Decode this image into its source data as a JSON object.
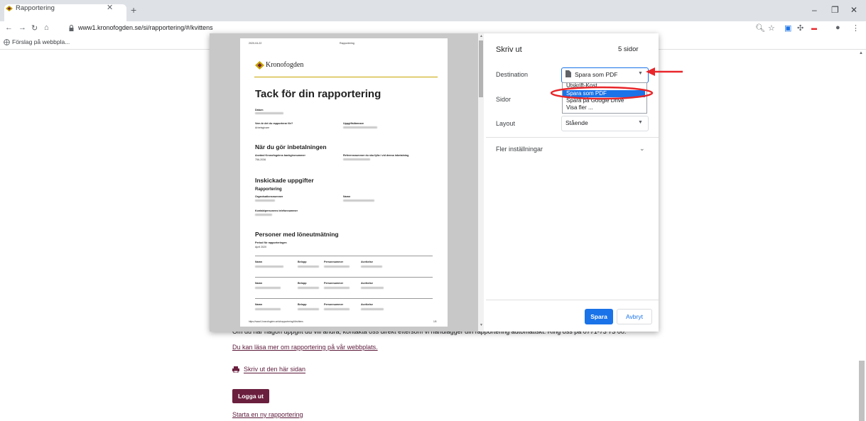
{
  "browser": {
    "tab_title": "Rapportering",
    "url": "www1.kronofogden.se/si/rapportering/#/kvittens",
    "bookmark": "Förslag på webbpla..."
  },
  "page": {
    "info_text": "Om du har någon uppgift du vill ändra, kontakta oss direkt eftersom vi handlägger din rapportering automatiskt. Ring oss på 0771-73 73 00.",
    "read_more_link": "Du kan läsa mer om rapportering på vår webbplats.",
    "print_link": "Skriv ut den här sidan",
    "logout_button": "Logga ut",
    "new_report_link": "Starta en ny rapportering"
  },
  "print_dialog": {
    "title": "Skriv ut",
    "page_count": "5 sidor",
    "destination_label": "Destination",
    "destination_value": "Spara som PDF",
    "destination_options": [
      "Utskrift-Kost",
      "Spara som PDF",
      "Spara på Google Drive",
      "Visa fler ..."
    ],
    "pages_label": "Sidor",
    "layout_label": "Layout",
    "layout_value": "Stående",
    "more_settings": "Fler inställningar",
    "save_button": "Spara",
    "cancel_button": "Avbryt"
  },
  "preview": {
    "date": "2020-04-22",
    "header_center": "Rapportering",
    "logo_text": "Kronofogden",
    "heading": "Tack för din rapportering",
    "datum_label": "Datum",
    "vem_label": "Vem är det du rapporterar för?",
    "vem_value": "Arbetsgivare",
    "uppgift_label": "Uppgiftslämnare",
    "inbetalning_heading": "När du gör inbetalningen",
    "bankgiro_label": "Använd Kronofogdens bankgironummer",
    "bankgiro_value": "756-2036",
    "referens_label": "Referensnummer du ska fylla i vid denna inbetalning",
    "inskickade_heading": "Inskickade uppgifter",
    "rapportering_sub": "Rapportering",
    "org_label": "Organisationsnummer",
    "namn_label": "Namn",
    "kontakt_label": "Kontaktpersonens telefonnummer",
    "personer_heading": "Personer med löneutmätning",
    "period_label": "Period för rapporteringen",
    "period_value": "April 2020",
    "col_namn": "Namn",
    "col_belopp": "Belopp",
    "col_personnummer": "Personnummer",
    "col_avvikelse": "Avvikelse",
    "footer_url": "https://www1.kronofogden.se/si/rapportering/#/kvittens",
    "footer_page": "1/5"
  },
  "colors": {
    "accent": "#1a73e8",
    "brand": "#6b1f3f",
    "annotation": "#e8262a"
  }
}
